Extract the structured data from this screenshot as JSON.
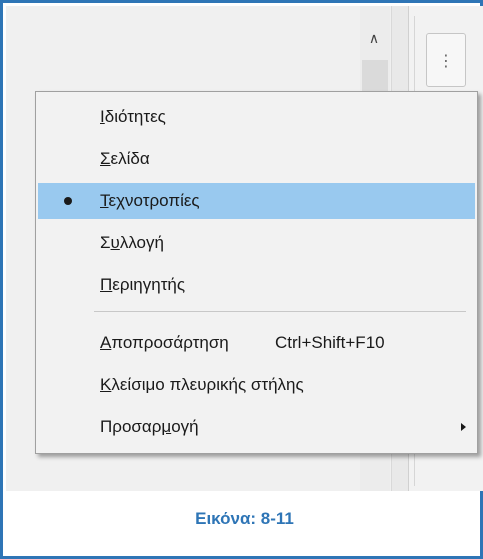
{
  "menu": {
    "items": [
      {
        "mnemonic": "Ι",
        "rest": "διότητες",
        "selected": false
      },
      {
        "mnemonic": "Σ",
        "rest": "ελίδα",
        "selected": false
      },
      {
        "mnemonic": "Τ",
        "rest": "εχνοτροπίες",
        "selected": true
      },
      {
        "pre": "Σ",
        "mnemonic": "υ",
        "rest": "λλογή",
        "selected": false
      },
      {
        "mnemonic": "Π",
        "rest": "εριηγητής",
        "selected": false
      }
    ],
    "items2": [
      {
        "mnemonic": "Α",
        "rest": "ποπροσάρτηση",
        "shortcut": "Ctrl+Shift+F10"
      },
      {
        "mnemonic": "Κ",
        "rest": "λείσιμο πλευρικής στήλης"
      },
      {
        "pre": "Προσαρ",
        "mnemonic": "μ",
        "rest": "ογή",
        "has_submenu": true
      }
    ]
  },
  "toolbar": {
    "scroll_up_icon": "chevron-up-icon",
    "more_icon": "vertical-ellipsis-icon"
  },
  "caption": "Εικόνα: 8-11",
  "colors": {
    "frame_border": "#2e75b6",
    "caption": "#2e75b6",
    "selected_item": "#99c9ef",
    "menu_background": "#f2f2f2"
  }
}
